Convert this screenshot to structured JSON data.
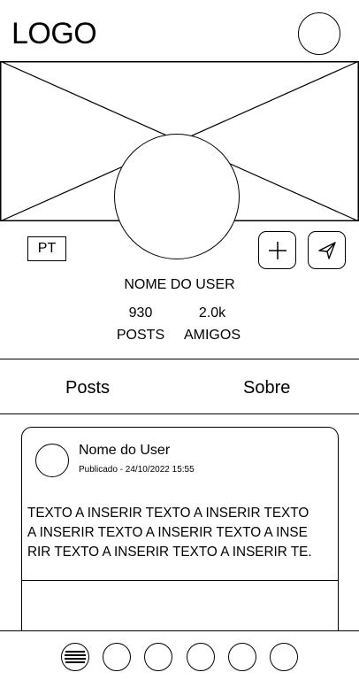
{
  "header": {
    "logo_text": "LOGO",
    "avatar_icon": "user-avatar-icon"
  },
  "profile": {
    "language": "PT",
    "username": "NOME DO USER",
    "stats": {
      "posts_value": "930",
      "posts_label": "POSTS",
      "friends_value": "2.0k",
      "friends_label": "AMIGOS"
    },
    "actions": {
      "add_icon": "plus-icon",
      "send_icon": "send-icon"
    }
  },
  "tabs": [
    {
      "label": "Posts"
    },
    {
      "label": "Sobre"
    }
  ],
  "post": {
    "author": "Nome do User",
    "published": "Publicado - 24/10/2022 15:55",
    "text_lines": [
      "TEXTO A INSERIR TEXTO A INSERIR TEXTO",
      "A INSERIR TEXTO A INSERIR TEXTO A INSE",
      "RIR TEXTO A INSERIR TEXTO A INSERIR TE."
    ]
  },
  "bottom_nav": {
    "items": [
      "menu-icon",
      "nav-circle-icon",
      "nav-circle-icon",
      "nav-circle-icon",
      "nav-circle-icon",
      "nav-circle-icon"
    ]
  }
}
